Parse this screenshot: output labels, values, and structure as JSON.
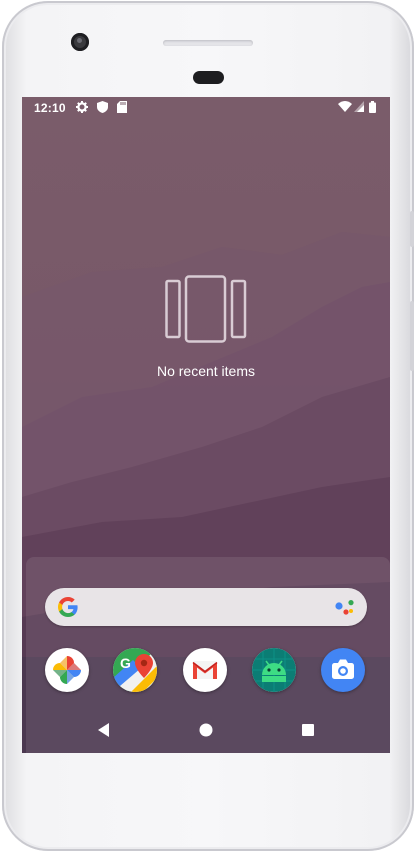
{
  "status_bar": {
    "time": "12:10",
    "left_icons": [
      "settings-icon",
      "shield-icon",
      "sd-card-icon"
    ],
    "right_icons": [
      "wifi-icon",
      "signal-icon",
      "battery-icon"
    ]
  },
  "recents": {
    "empty_message": "No recent items",
    "empty_icon": "recents-cards-icon"
  },
  "search_bar": {
    "left_icon": "google-g-icon",
    "right_icon": "assistant-icon"
  },
  "dock_apps": [
    {
      "name": "Photos",
      "icon": "photos-icon"
    },
    {
      "name": "Maps",
      "icon": "maps-icon"
    },
    {
      "name": "Gmail",
      "icon": "gmail-icon"
    },
    {
      "name": "Android",
      "icon": "android-icon"
    },
    {
      "name": "Camera",
      "icon": "camera-icon"
    }
  ],
  "navigation": {
    "buttons": [
      "back-icon",
      "home-icon",
      "overview-icon"
    ]
  },
  "colors": {
    "wallpaper_top": "#7a5c6a",
    "wallpaper_bottom": "#5a3c52",
    "google_blue": "#4285F4",
    "google_red": "#EA4335",
    "google_yellow": "#FBBC05",
    "google_green": "#34A853"
  }
}
